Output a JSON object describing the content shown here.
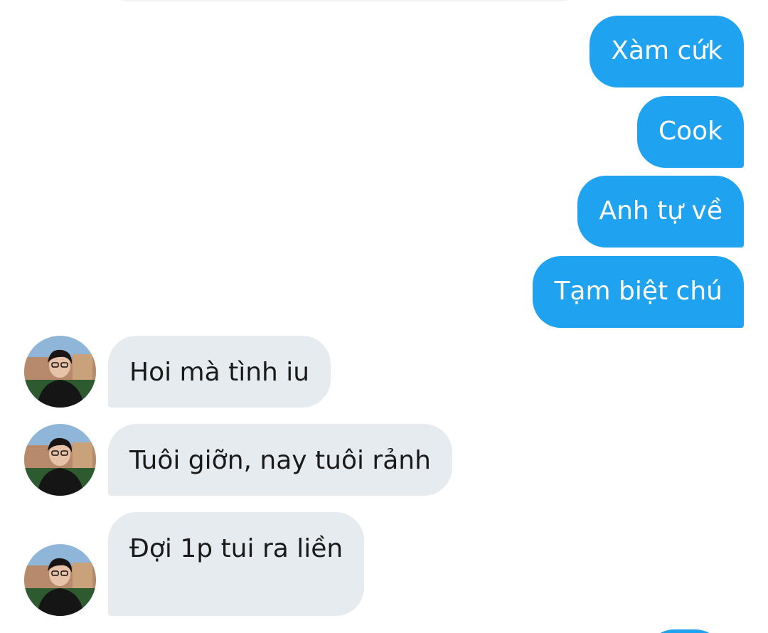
{
  "conversation": {
    "outgoing": [
      {
        "text": "Xàm cứk"
      },
      {
        "text": "Cook"
      },
      {
        "text": "Anh tự về"
      },
      {
        "text": "Tạm biệt chú"
      }
    ],
    "incoming": [
      {
        "text": "Hoi mà tình iu"
      },
      {
        "text": "Tuôi giỡn, nay tuôi rảnh"
      },
      {
        "text": "Đợi 1p tui ra liền"
      }
    ]
  },
  "colors": {
    "outgoing_bubble": "#1fa3f0",
    "incoming_bubble": "#e6ebef",
    "outgoing_text": "#ffffff",
    "incoming_text": "#1a1a1a"
  },
  "contact": {
    "avatar_icon": "profile-photo-avatar"
  }
}
